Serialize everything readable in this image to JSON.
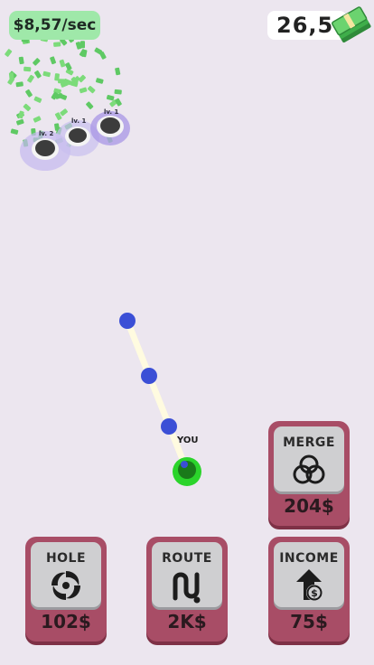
{
  "hud": {
    "income_rate": "$8,57/sec",
    "money": "26,5",
    "money_icon": "cash-stack-icon"
  },
  "holes": [
    {
      "level": "lv. 2"
    },
    {
      "level": "lv. 1"
    },
    {
      "level": "lv. 1"
    }
  ],
  "player": {
    "label": "YOU"
  },
  "upgrades": [
    {
      "id": "merge",
      "title": "MERGE",
      "price": "204$",
      "icon": "rings-icon"
    },
    {
      "id": "hole",
      "title": "HOLE",
      "price": "102$",
      "icon": "vortex-icon"
    },
    {
      "id": "route",
      "title": "ROUTE",
      "price": "2K$",
      "icon": "route-icon"
    },
    {
      "id": "income",
      "title": "INCOME",
      "price": "75$",
      "icon": "income-arrow-icon"
    }
  ],
  "colors": {
    "background": "#ece6ef",
    "card": "#a84d66",
    "card_inner": "#cfcfd1",
    "rate_pill": "#9fe8a9",
    "route_node": "#3b4fd6",
    "player": "#2bd42b"
  }
}
